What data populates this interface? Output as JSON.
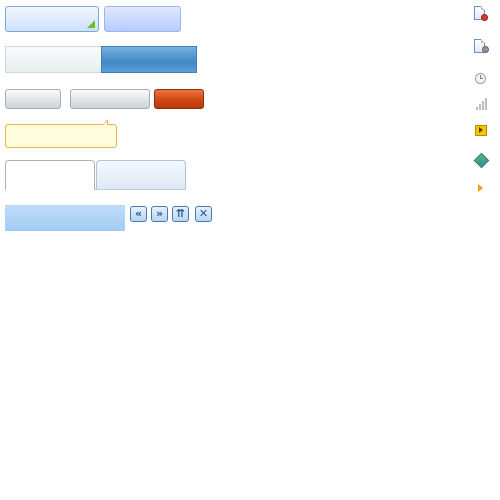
{
  "controls": {
    "dropdown_button_label": "",
    "light_button_label": "",
    "segment_left_label": "",
    "segment_right_label": "",
    "gray_button_a_label": "",
    "gray_button_b_label": "",
    "orange_button_label": "",
    "tooltip_text": "",
    "tab_active_label": "",
    "tab_inactive_label": "",
    "panel_header_title": ""
  },
  "toolbar": {
    "prev_glyph": "«",
    "next_glyph": "»",
    "up_glyph": "⇈",
    "close_glyph": "✕"
  },
  "icons": [
    "document-stop-icon",
    "document-settings-icon",
    "clock-icon",
    "signal-bars-icon",
    "play-icon",
    "diamond-icon",
    "arrow-right-icon"
  ],
  "colors": {
    "accent_blue": "#3f88c6",
    "accent_orange": "#cf4714",
    "tooltip_bg": "#fffbdd",
    "tooltip_border": "#e8b34a",
    "dropdown_corner": "#6fbf2c"
  }
}
